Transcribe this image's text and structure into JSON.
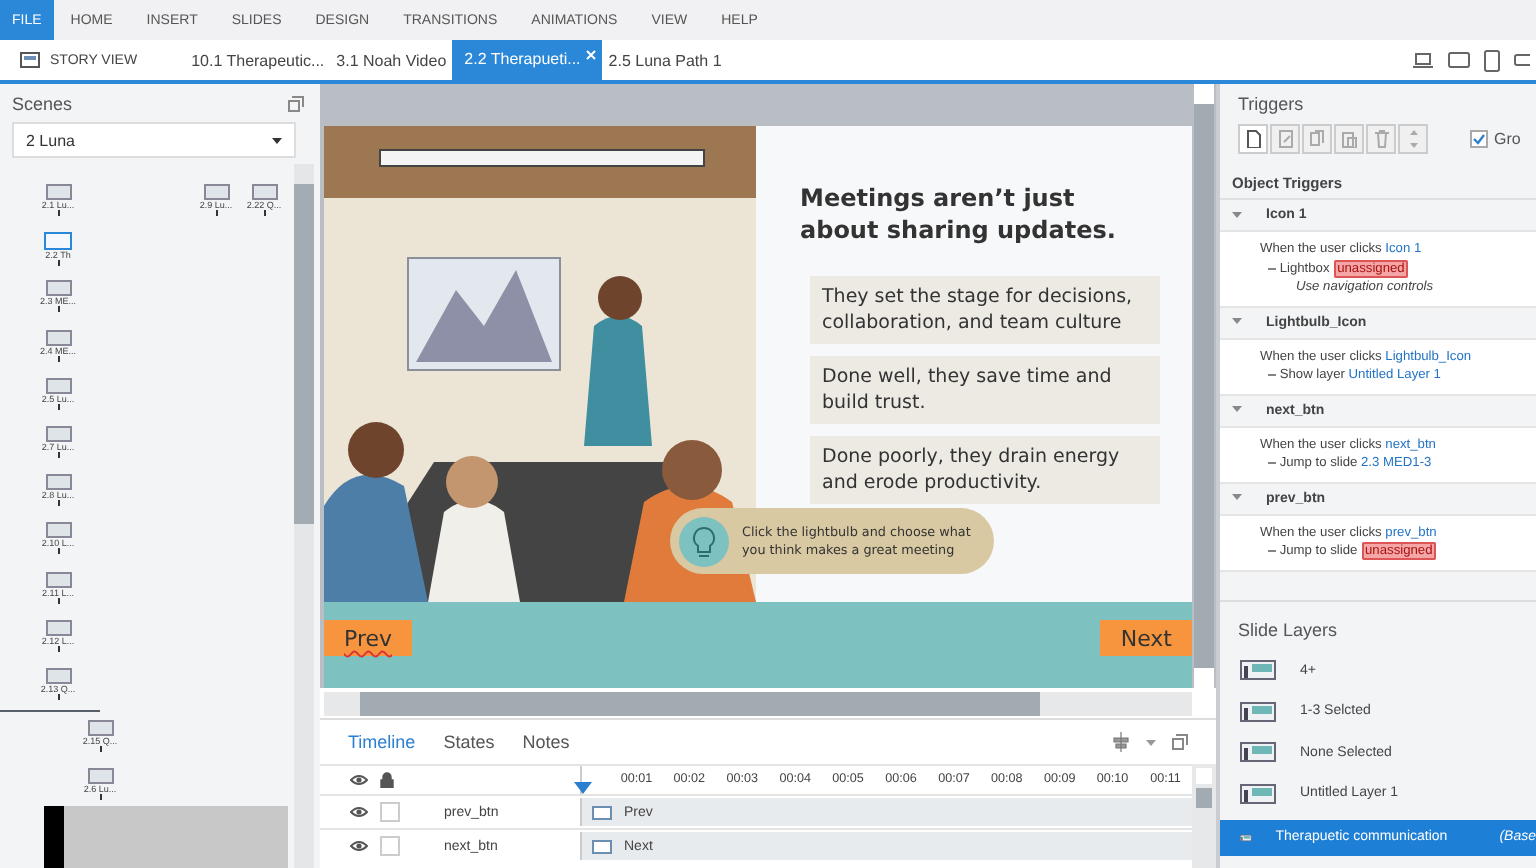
{
  "ribbon": {
    "tabs": [
      {
        "label": "FILE",
        "selected": true
      },
      {
        "label": "HOME",
        "selected": false
      },
      {
        "label": "INSERT",
        "selected": false
      },
      {
        "label": "SLIDES",
        "selected": false
      },
      {
        "label": "DESIGN",
        "selected": false
      },
      {
        "label": "TRANSITIONS",
        "selected": false
      },
      {
        "label": "ANIMATIONS",
        "selected": false
      },
      {
        "label": "VIEW",
        "selected": false
      },
      {
        "label": "HELP",
        "selected": false
      }
    ]
  },
  "doc_tabs": {
    "story_view": "STORY VIEW",
    "tabs": [
      {
        "label": "10.1 Therapeutic...",
        "selected": false
      },
      {
        "label": "3.1 Noah Video",
        "selected": false
      },
      {
        "label": "2.2 Therapueti...",
        "selected": true
      },
      {
        "label": "2.5 Luna Path 1",
        "selected": false
      }
    ]
  },
  "scenes": {
    "title": "Scenes",
    "dropdown": "2 Luna",
    "map": {
      "main": [
        {
          "label": "2.1 Lu...",
          "selected": false
        },
        {
          "label": "2.2 Th",
          "selected": true
        },
        {
          "label": "2.3 ME...",
          "selected": false
        },
        {
          "label": "2.4 ME...",
          "selected": false
        },
        {
          "label": "2.5 Lu...",
          "selected": false
        },
        {
          "label": "2.7 Lu...",
          "selected": false
        },
        {
          "label": "2.8 Lu...",
          "selected": false
        },
        {
          "label": "2.10 L...",
          "selected": false
        },
        {
          "label": "2.11 L...",
          "selected": false
        },
        {
          "label": "2.12 L...",
          "selected": false
        },
        {
          "label": "2.13 Q...",
          "selected": false
        }
      ],
      "branch_top": [
        {
          "label": "2.9 Lu...",
          "selected": false
        },
        {
          "label": "2.22 Q...",
          "selected": false
        }
      ],
      "branch_bottom": [
        {
          "label": "2.15 Q...",
          "selected": false
        },
        {
          "label": "2.6 Lu...",
          "selected": false
        }
      ]
    }
  },
  "slide": {
    "heading": "Meetings aren’t just about sharing updates.",
    "points": [
      "They set the stage for decisions, collaboration, and team culture",
      "Done well, they save time and build trust.",
      "Done poorly, they drain energy and erode productivity."
    ],
    "callout": "Click the lightbulb and choose what you think makes a great meeting",
    "prev": "Prev",
    "next": "Next"
  },
  "timeline": {
    "tabs": [
      {
        "label": "Timeline",
        "selected": true
      },
      {
        "label": "States",
        "selected": false
      },
      {
        "label": "Notes",
        "selected": false
      }
    ],
    "ticks": [
      "00:01",
      "00:02",
      "00:03",
      "00:04",
      "00:05",
      "00:06",
      "00:07",
      "00:08",
      "00:09",
      "00:10",
      "00:11"
    ],
    "rows": [
      {
        "name": "prev_btn",
        "bar": "Prev",
        "visible": true,
        "locked": false
      },
      {
        "name": "next_btn",
        "bar": "Next",
        "visible": true,
        "locked": false
      }
    ]
  },
  "triggers": {
    "title": "Triggers",
    "group_option": {
      "label": "Gro",
      "checked": true
    },
    "section": "Object Triggers",
    "groups": [
      {
        "name": "Icon 1",
        "expanded": true,
        "event": "When the user clicks",
        "object": "Icon 1",
        "action": "Lightbox",
        "target": "unassigned",
        "assigned": false,
        "note": "Use navigation controls"
      },
      {
        "name": "Lightbulb_Icon",
        "expanded": true,
        "event": "When the user clicks",
        "object": "Lightbulb_Icon",
        "action": "Show layer",
        "target": "Untitled Layer 1",
        "assigned": true
      },
      {
        "name": "next_btn",
        "expanded": true,
        "event": "When the user clicks",
        "object": "next_btn",
        "action": "Jump to slide",
        "target": "2.3 MED1-3",
        "assigned": true
      },
      {
        "name": "prev_btn",
        "expanded": true,
        "event": "When the user clicks",
        "object": "prev_btn",
        "action": "Jump to slide",
        "target": "unassigned",
        "assigned": false
      }
    ]
  },
  "layers": {
    "title": "Slide Layers",
    "items": [
      {
        "name": "4+",
        "selected": false
      },
      {
        "name": "1-3 Selcted",
        "selected": false
      },
      {
        "name": "None Selected",
        "selected": false
      },
      {
        "name": "Untitled Layer 1",
        "selected": false
      },
      {
        "name": "Therapuetic communication",
        "base": "(Base",
        "selected": true
      }
    ]
  }
}
